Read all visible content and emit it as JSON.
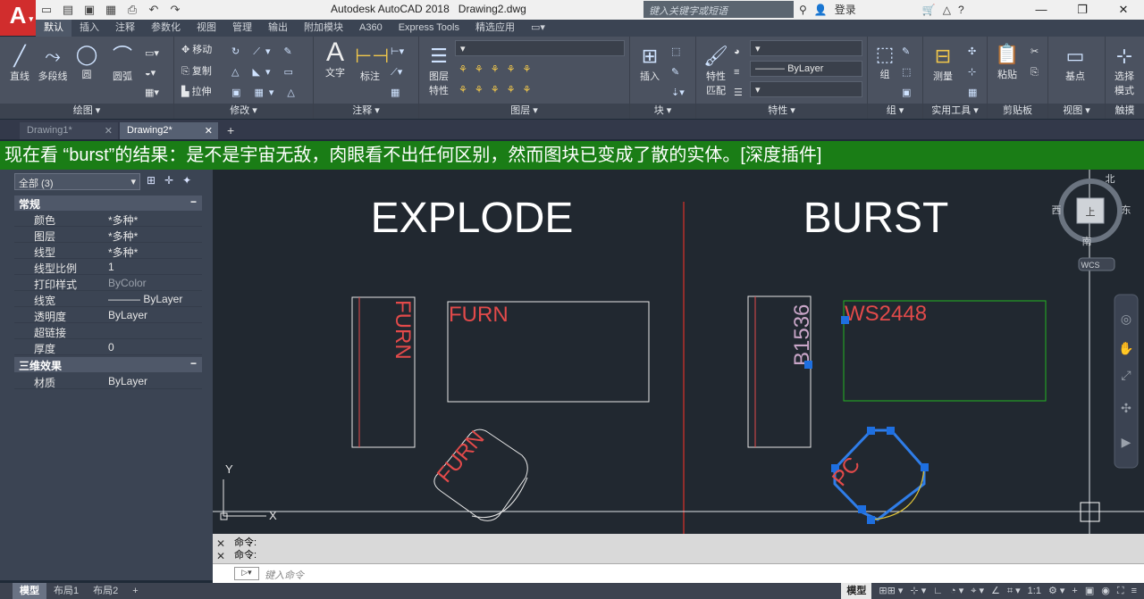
{
  "window": {
    "title": "Autodesk AutoCAD 2018",
    "document": "Drawing2.dwg"
  },
  "app_logo": {
    "letter": "A",
    "arrow": "▾"
  },
  "qat_icons": [
    "📄",
    "📂",
    "💾",
    "💾",
    "🖨",
    "↶",
    "↷"
  ],
  "search": {
    "placeholder": "键入关键字或短语"
  },
  "login": {
    "label": "登录"
  },
  "ribbon_tabs": [
    "默认",
    "插入",
    "注释",
    "参数化",
    "视图",
    "管理",
    "输出",
    "附加模块",
    "A360",
    "Express Tools",
    "精选应用"
  ],
  "ribbon": {
    "draw": {
      "title": "绘图 ▾",
      "line": "直线",
      "polyline": "多段线",
      "circle": "圆",
      "arc": "圆弧"
    },
    "modify": {
      "title": "修改 ▾",
      "move": "移动",
      "copy": "复制",
      "stretch": "拉伸"
    },
    "annot": {
      "title": "注释 ▾",
      "text": "文字",
      "dim": "标注"
    },
    "layers": {
      "title": "图层 ▾",
      "layer_props": "图层\n特性"
    },
    "block": {
      "title": "块 ▾",
      "insert": "插入"
    },
    "properties": {
      "title": "特性 ▾",
      "match": "特性\n匹配",
      "bylayer": "ByLayer"
    },
    "groups": {
      "title": "组 ▾",
      "group": "组"
    },
    "utilities": {
      "title": "实用工具 ▾",
      "measure": "测量"
    },
    "clipboard": {
      "title": "剪贴板",
      "paste": "粘贴"
    },
    "view": {
      "title": "视图 ▾",
      "basepoint": "基点"
    },
    "touch": {
      "title": "触摸",
      "select_mode": "选择\n模式"
    }
  },
  "doc_tabs": [
    {
      "label": "Drawing1*",
      "active": false
    },
    {
      "label": "Drawing2*",
      "active": true
    }
  ],
  "banner": {
    "text": "现在看 “burst”的结果：是不是宇宙无敌，肉眼看不出任何区别，然而图块已变成了散的实体。[深度插件]"
  },
  "properties": {
    "selection": "全部 (3)",
    "general": {
      "title": "常规",
      "rows": [
        {
          "k": "颜色",
          "v": "*多种*"
        },
        {
          "k": "图层",
          "v": "*多种*"
        },
        {
          "k": "线型",
          "v": "*多种*"
        },
        {
          "k": "线型比例",
          "v": "1"
        },
        {
          "k": "打印样式",
          "v": "ByColor"
        },
        {
          "k": "线宽",
          "v": "——— ByLayer"
        },
        {
          "k": "透明度",
          "v": "ByLayer"
        },
        {
          "k": "超链接",
          "v": ""
        },
        {
          "k": "厚度",
          "v": "0"
        }
      ]
    },
    "three_d": {
      "title": "三维效果",
      "rows": [
        {
          "k": "材质",
          "v": "ByLayer"
        }
      ]
    }
  },
  "canvas": {
    "left_title": "EXPLODE",
    "right_title": "BURST",
    "labels": {
      "furn_vertical": "FURN",
      "furn_rect": "FURN",
      "furn_chair": "FURN",
      "b1536": "B1536",
      "ws2448": "WS2448",
      "pc": "PC"
    },
    "viewcube": {
      "north": "北",
      "south": "南",
      "west": "西",
      "east": "东",
      "face": "上",
      "wcs": "WCS"
    },
    "ucs": {
      "y": "Y",
      "x": "X"
    }
  },
  "command": {
    "history": [
      "命令:",
      "命令:"
    ],
    "placeholder": "键入命令"
  },
  "layout_tabs": [
    "模型",
    "布局1",
    "布局2"
  ],
  "status": {
    "model": "模型",
    "scale": "1:1"
  },
  "colors": {
    "accent_red": "#d12d2d",
    "banner_green": "#1a7d16",
    "canvas_bg": "#212830"
  }
}
